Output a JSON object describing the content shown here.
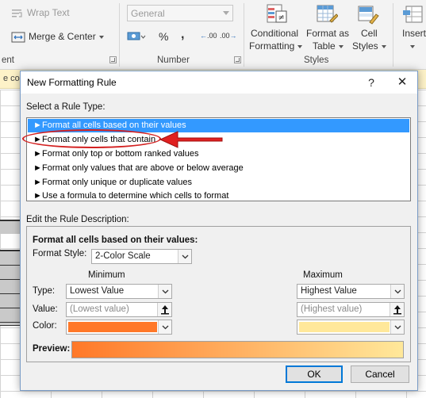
{
  "ribbon": {
    "wrap_text": "Wrap Text",
    "merge_center": "Merge & Center",
    "number_format": "General",
    "percent": "%",
    "comma": ",",
    "inc_decimal": ".00",
    "dec_decimal": ".00",
    "conditional_formatting": [
      "Conditional",
      "Formatting"
    ],
    "format_as_table": [
      "Format as",
      "Table"
    ],
    "cell_styles": [
      "Cell",
      "Styles"
    ],
    "insert": "Insert",
    "group_alignment": "ent",
    "group_number": "Number",
    "group_styles": "Styles"
  },
  "hint_strip": "e cou",
  "dialog": {
    "title": "New Formatting Rule",
    "help": "?",
    "close": "✕",
    "select_rule_type_label": "Select a Rule Type:",
    "rule_types": [
      "Format all cells based on their values",
      "Format only cells that contain",
      "Format only top or bottom ranked values",
      "Format only values that are above or below average",
      "Format only unique or duplicate values",
      "Use a formula to determine which cells to format"
    ],
    "selected_index": 0,
    "edit_desc_label": "Edit the Rule Description:",
    "desc_heading": "Format all cells based on their values:",
    "format_style_label": "Format Style:",
    "format_style_value": "2-Color Scale",
    "minimum_header": "Minimum",
    "maximum_header": "Maximum",
    "type_label": "Type:",
    "value_label": "Value:",
    "color_label": "Color:",
    "min_type": "Lowest Value",
    "max_type": "Highest Value",
    "min_value_placeholder": "(Lowest value)",
    "max_value_placeholder": "(Highest value)",
    "min_color": "#ff7828",
    "max_color": "#ffe89a",
    "preview_label": "Preview:",
    "ok": "OK",
    "cancel": "Cancel"
  },
  "colors": {
    "accent_blue": "#3399ff",
    "annotation_red": "#d32020"
  }
}
